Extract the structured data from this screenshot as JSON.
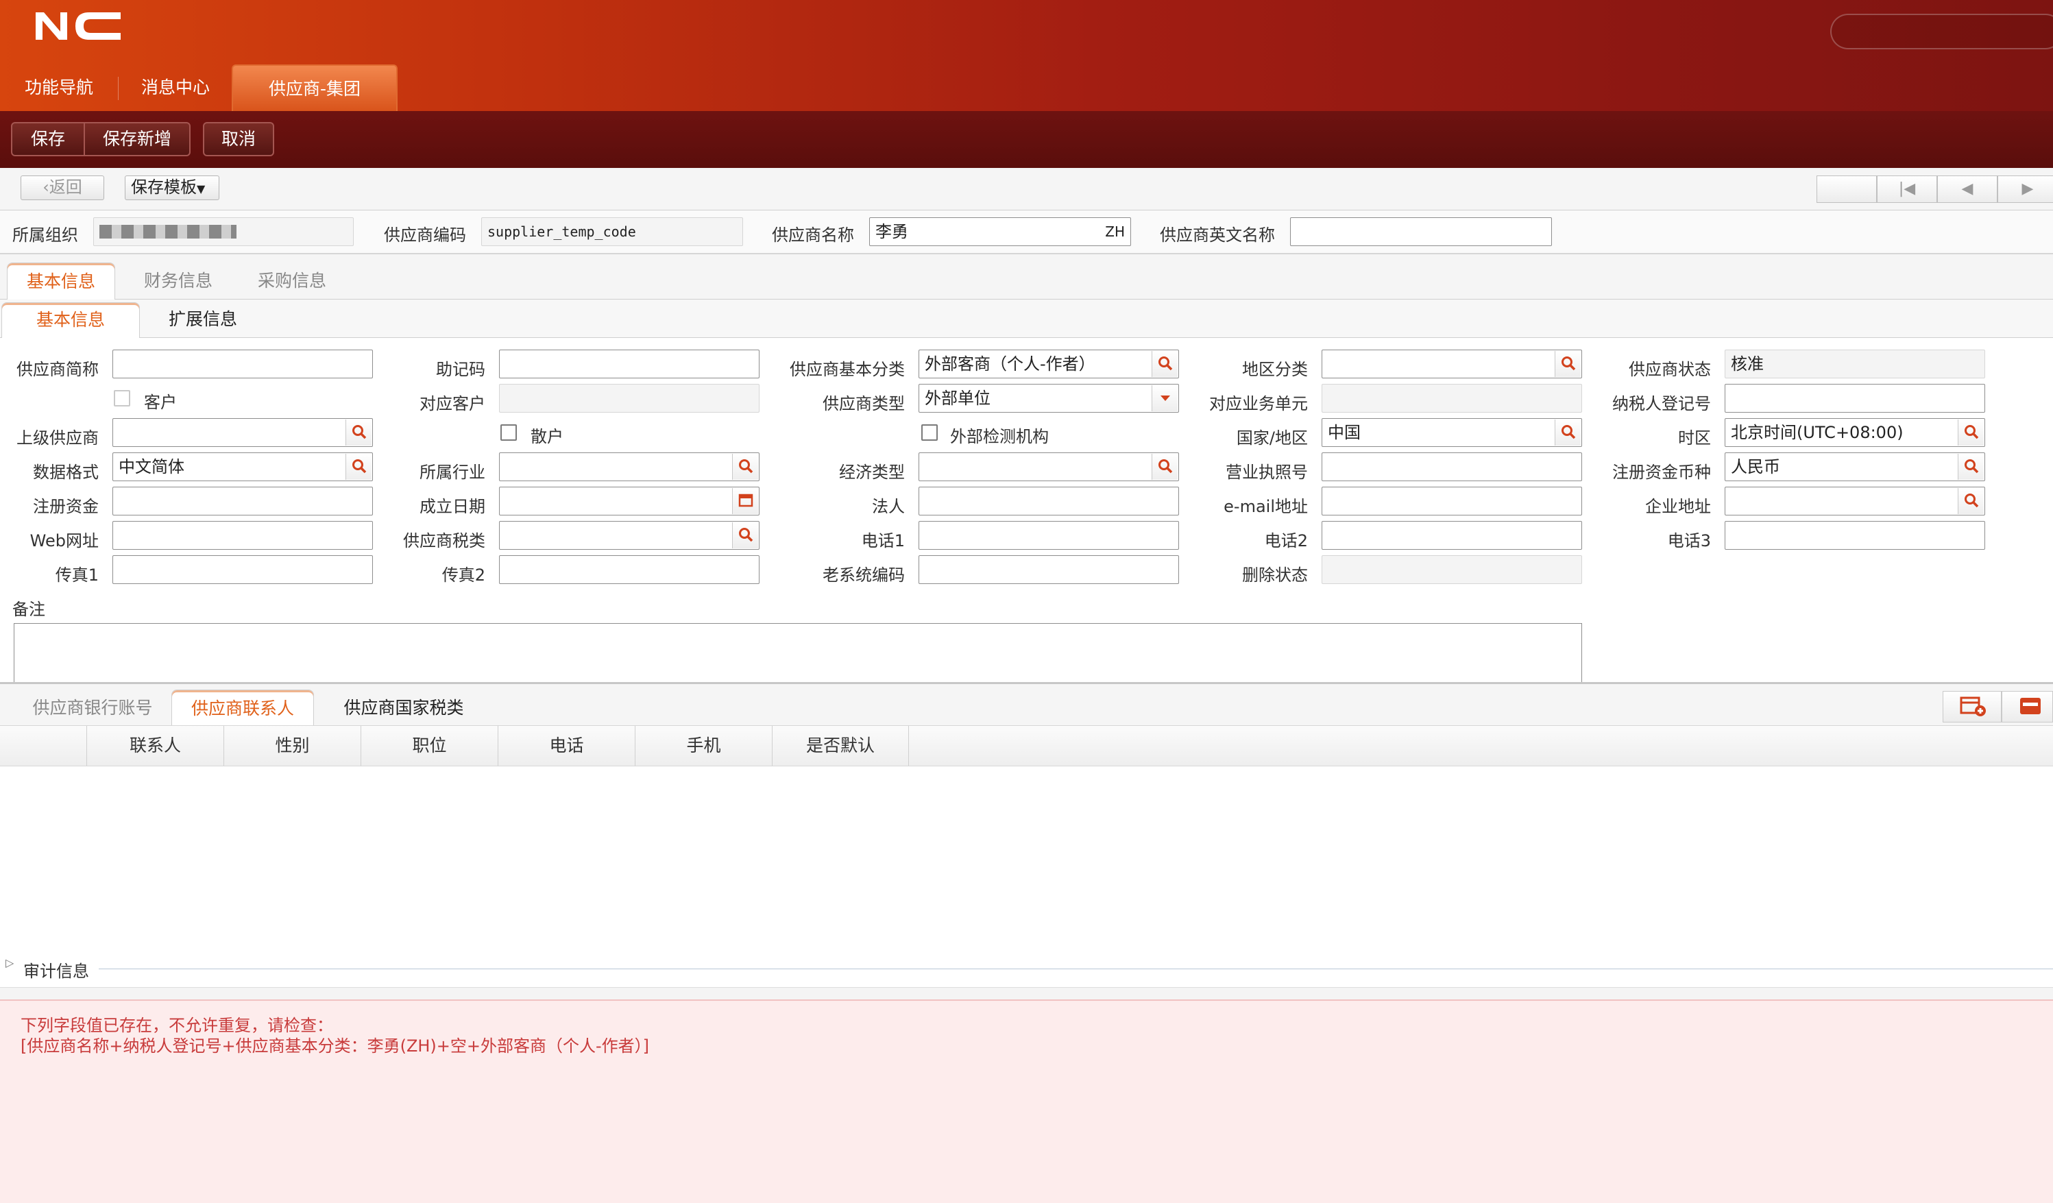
{
  "app": {
    "logo": "NC"
  },
  "top_tabs": [
    "功能导航",
    "消息中心",
    "供应商-集团"
  ],
  "action_buttons": {
    "save": "保存",
    "save_new": "保存新增",
    "cancel": "取消"
  },
  "toolbar": {
    "back": "返回",
    "save_template": "保存模板"
  },
  "header_fields": {
    "org_label": "所属组织",
    "code_label": "供应商编码",
    "code_value": "supplier_temp_code",
    "name_label": "供应商名称",
    "name_value": "李勇",
    "name_lang": "ZH",
    "en_name_label": "供应商英文名称"
  },
  "main_tabs": [
    "基本信息",
    "财务信息",
    "采购信息"
  ],
  "sub_tabs": [
    "基本信息",
    "扩展信息"
  ],
  "form": {
    "short_name": "供应商简称",
    "customer": "客户",
    "parent_supplier": "上级供应商",
    "data_format": "数据格式",
    "data_format_value": "中文简体",
    "reg_capital": "注册资金",
    "web": "Web网址",
    "fax1": "传真1",
    "mnemonic": "助记码",
    "corr_customer": "对应客户",
    "retail": "散户",
    "industry": "所属行业",
    "found_date": "成立日期",
    "tax_class": "供应商税类",
    "fax2": "传真2",
    "basic_class": "供应商基本分类",
    "basic_class_value": "外部客商（个人-作者）",
    "supplier_type": "供应商类型",
    "supplier_type_value": "外部单位",
    "ext_inspect": "外部检测机构",
    "econ_type": "经济类型",
    "legal_person": "法人",
    "phone1": "电话1",
    "old_code": "老系统编码",
    "region": "地区分类",
    "corr_unit": "对应业务单元",
    "country": "国家/地区",
    "country_value": "中国",
    "license": "营业执照号",
    "email": "e-mail地址",
    "phone2": "电话2",
    "delete_status": "删除状态",
    "status": "供应商状态",
    "status_value": "核准",
    "taxpayer_no": "纳税人登记号",
    "timezone": "时区",
    "timezone_value": "北京时间(UTC+08:00)",
    "currency": "注册资金币种",
    "currency_value": "人民币",
    "address": "企业地址",
    "phone3": "电话3",
    "remarks": "备注"
  },
  "bottom_tabs": [
    "供应商银行账号",
    "供应商联系人",
    "供应商国家税类"
  ],
  "grid_columns": [
    "联系人",
    "性别",
    "职位",
    "电话",
    "手机",
    "是否默认"
  ],
  "audit_label": "审计信息",
  "error": {
    "line1": "下列字段值已存在，不允许重复，请检查：",
    "line2": "[供应商名称+纳税人登记号+供应商基本分类：李勇(ZH)+空+外部客商（个人-作者）]"
  },
  "colors": {
    "brand": "#c1310e",
    "accent_tab": "#e0611a",
    "error_text": "#c83b3b"
  }
}
